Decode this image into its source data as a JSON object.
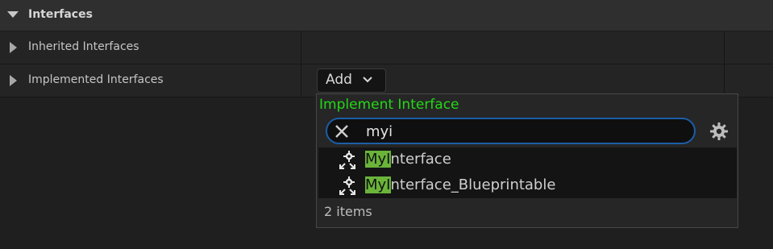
{
  "section": {
    "title": "Interfaces"
  },
  "rows": [
    {
      "label": "Inherited Interfaces"
    },
    {
      "label": "Implemented Interfaces"
    }
  ],
  "add_button": {
    "label": "Add"
  },
  "popup": {
    "title": "Implement Interface",
    "search": {
      "value": "myi",
      "placeholder": ""
    },
    "items": [
      {
        "match": "MyI",
        "rest": "nterface",
        "icon": "interface-icon"
      },
      {
        "match": "MyI",
        "rest": "nterface_Blueprintable",
        "icon": "interface-icon"
      }
    ],
    "count_label": "2 items"
  },
  "colors": {
    "accent_green": "#24d818",
    "highlight": "#6ab43a",
    "focus_border": "#1c5ea8"
  }
}
